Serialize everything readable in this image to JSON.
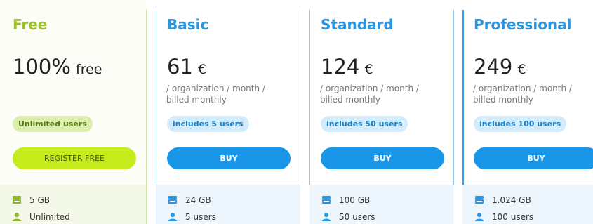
{
  "colors": {
    "free_accent": "#9ec02a",
    "paid_accent": "#2b95e0",
    "free_cta_bg": "#c6ec1d",
    "paid_cta_bg": "#1996e8"
  },
  "plans": [
    {
      "name": "Free",
      "price_amount": "100%",
      "price_unit": "free",
      "price_note": "",
      "badge": "Unlimited users",
      "cta": "REGISTER FREE",
      "features": [
        {
          "icon": "storage-icon",
          "text": "5 GB"
        },
        {
          "icon": "user-icon",
          "text": "Unlimited"
        }
      ]
    },
    {
      "name": "Basic",
      "price_amount": "61",
      "price_unit": "€",
      "price_note": "/ organization / month / billed monthly",
      "badge": "includes 5 users",
      "cta": "BUY",
      "features": [
        {
          "icon": "storage-icon",
          "text": "24 GB"
        },
        {
          "icon": "user-icon",
          "text": "5 users"
        }
      ]
    },
    {
      "name": "Standard",
      "price_amount": "124",
      "price_unit": "€",
      "price_note": "/ organization / month / billed monthly",
      "badge": "includes 50 users",
      "cta": "BUY",
      "features": [
        {
          "icon": "storage-icon",
          "text": "100 GB"
        },
        {
          "icon": "user-icon",
          "text": "50 users"
        }
      ]
    },
    {
      "name": "Professional",
      "price_amount": "249",
      "price_unit": "€",
      "price_note": "/ organization / month / billed monthly",
      "badge": "includes 100 users",
      "cta": "BUY",
      "features": [
        {
          "icon": "storage-icon",
          "text": "1.024 GB"
        },
        {
          "icon": "user-icon",
          "text": "100 users"
        }
      ]
    }
  ]
}
